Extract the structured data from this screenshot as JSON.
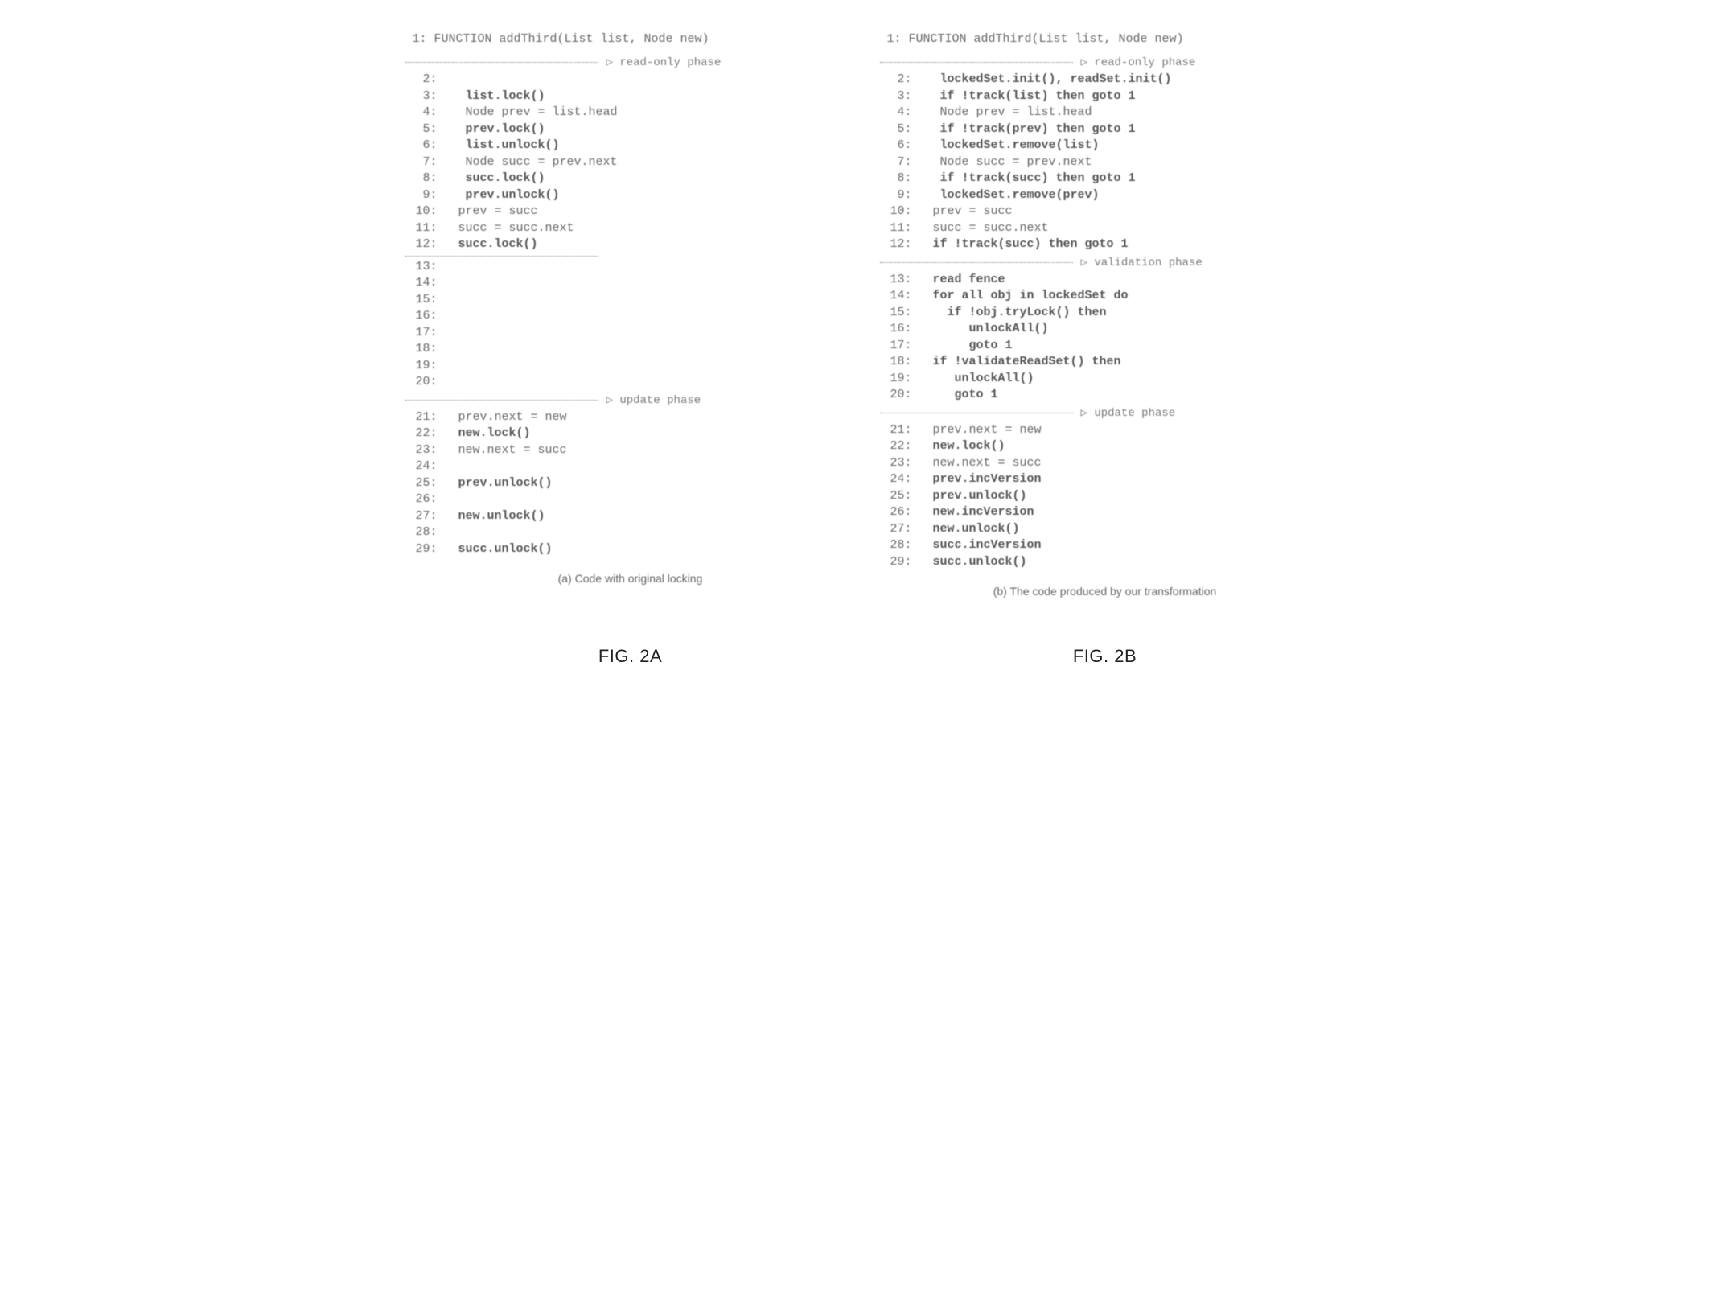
{
  "left": {
    "title": " 1: FUNCTION addThird(List list, Node new)",
    "phase_readonly": "▷ read-only phase",
    "lines_a": [
      {
        "n": "2:",
        "code": "",
        "bold": false
      },
      {
        "n": "3:",
        "code": "   list.lock()",
        "bold": true
      },
      {
        "n": "4:",
        "code": "   Node prev = list.head",
        "bold": false
      },
      {
        "n": "5:",
        "code": "   prev.lock()",
        "bold": true
      },
      {
        "n": "6:",
        "code": "   list.unlock()",
        "bold": true
      },
      {
        "n": "7:",
        "code": "   Node succ = prev.next",
        "bold": false
      },
      {
        "n": "8:",
        "code": "   succ.lock()",
        "bold": true
      },
      {
        "n": "9:",
        "code": "   prev.unlock()",
        "bold": true
      },
      {
        "n": "10:",
        "code": "  prev = succ",
        "bold": false
      },
      {
        "n": "11:",
        "code": "  succ = succ.next",
        "bold": false
      },
      {
        "n": "12:",
        "code": "  succ.lock()",
        "bold": true
      }
    ],
    "lines_b": [
      {
        "n": "13:",
        "code": "",
        "bold": false
      },
      {
        "n": "14:",
        "code": "",
        "bold": false
      },
      {
        "n": "15:",
        "code": "",
        "bold": false
      },
      {
        "n": "16:",
        "code": "",
        "bold": false
      },
      {
        "n": "17:",
        "code": "",
        "bold": false
      },
      {
        "n": "18:",
        "code": "",
        "bold": false
      },
      {
        "n": "19:",
        "code": "",
        "bold": false
      },
      {
        "n": "20:",
        "code": "",
        "bold": false
      }
    ],
    "phase_update": "▷ update phase",
    "lines_c": [
      {
        "n": "21:",
        "code": "  prev.next = new",
        "bold": false
      },
      {
        "n": "22:",
        "code": "  new.lock()",
        "bold": true
      },
      {
        "n": "23:",
        "code": "  new.next = succ",
        "bold": false
      },
      {
        "n": "24:",
        "code": "",
        "bold": false
      },
      {
        "n": "25:",
        "code": "  prev.unlock()",
        "bold": true
      },
      {
        "n": "26:",
        "code": "",
        "bold": false
      },
      {
        "n": "27:",
        "code": "  new.unlock()",
        "bold": true
      },
      {
        "n": "28:",
        "code": "",
        "bold": false
      },
      {
        "n": "29:",
        "code": "  succ.unlock()",
        "bold": true
      }
    ],
    "caption": "(a) Code with original locking",
    "fig": "FIG. 2A"
  },
  "right": {
    "title": " 1: FUNCTION addThird(List list, Node new)",
    "phase_readonly": "▷ read-only phase",
    "lines_a": [
      {
        "n": "2:",
        "code": "   lockedSet.init(), readSet.init()",
        "bold": true
      },
      {
        "n": "3:",
        "code": "   if !track(list) then goto 1",
        "bold": true
      },
      {
        "n": "4:",
        "code": "   Node prev = list.head",
        "bold": false
      },
      {
        "n": "5:",
        "code": "   if !track(prev) then goto 1",
        "bold": true
      },
      {
        "n": "6:",
        "code": "   lockedSet.remove(list)",
        "bold": true
      },
      {
        "n": "7:",
        "code": "   Node succ = prev.next",
        "bold": false
      },
      {
        "n": "8:",
        "code": "   if !track(succ) then goto 1",
        "bold": true
      },
      {
        "n": "9:",
        "code": "   lockedSet.remove(prev)",
        "bold": true
      },
      {
        "n": "10:",
        "code": "  prev = succ",
        "bold": false
      },
      {
        "n": "11:",
        "code": "  succ = succ.next",
        "bold": false
      },
      {
        "n": "12:",
        "code": "  if !track(succ) then goto 1",
        "bold": true
      }
    ],
    "phase_validation": "▷ validation phase",
    "lines_b": [
      {
        "n": "13:",
        "code": "  read fence",
        "bold": true
      },
      {
        "n": "14:",
        "code": "  for all obj in lockedSet do",
        "bold": true
      },
      {
        "n": "15:",
        "code": "    if !obj.tryLock() then",
        "bold": true
      },
      {
        "n": "16:",
        "code": "       unlockAll()",
        "bold": true
      },
      {
        "n": "17:",
        "code": "       goto 1",
        "bold": true
      },
      {
        "n": "18:",
        "code": "  if !validateReadSet() then",
        "bold": true
      },
      {
        "n": "19:",
        "code": "     unlockAll()",
        "bold": true
      },
      {
        "n": "20:",
        "code": "     goto 1",
        "bold": true
      }
    ],
    "phase_update": "▷ update phase",
    "lines_c": [
      {
        "n": "21:",
        "code": "  prev.next = new",
        "bold": false
      },
      {
        "n": "22:",
        "code": "  new.lock()",
        "bold": true
      },
      {
        "n": "23:",
        "code": "  new.next = succ",
        "bold": false
      },
      {
        "n": "24:",
        "code": "  prev.incVersion",
        "bold": true
      },
      {
        "n": "25:",
        "code": "  prev.unlock()",
        "bold": true
      },
      {
        "n": "26:",
        "code": "  new.incVersion",
        "bold": true
      },
      {
        "n": "27:",
        "code": "  new.unlock()",
        "bold": true
      },
      {
        "n": "28:",
        "code": "  succ.incVersion",
        "bold": true
      },
      {
        "n": "29:",
        "code": "  succ.unlock()",
        "bold": true
      }
    ],
    "caption": "(b) The code produced by our transformation",
    "fig": "FIG. 2B"
  }
}
